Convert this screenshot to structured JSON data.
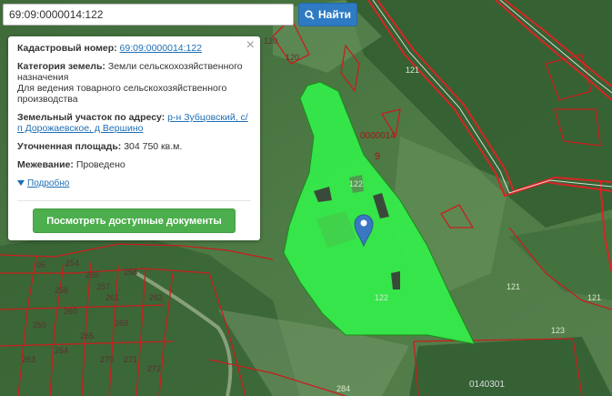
{
  "search": {
    "value": "69:09:0000014:122",
    "button_label": "Найти"
  },
  "popup": {
    "cadastral_label": "Кадастровый номер:",
    "cadastral_value": "69:09:0000014:122",
    "category_label": "Категория земель:",
    "category_value": "Земли сельскохозяйственного назначения",
    "purpose_value": "Для ведения товарного сельскохозяйственного производства",
    "address_label": "Земельный участок по адресу:",
    "address_value": "р-н Зубцовский, с/п Дорожаевское, д Вершино",
    "area_label": "Уточненная площадь:",
    "area_value": "304 750 кв.м.",
    "survey_label": "Межевание:",
    "survey_value": "Проведено",
    "more_label": "Подробно",
    "docs_button": "Посмотреть доступные документы",
    "close_glyph": "×"
  },
  "map": {
    "quarter_label": "0000014",
    "quarter_suffix": "9",
    "bottom_quarter_label": "0140301",
    "parcel_labels": [
      "121",
      "121",
      "121",
      "123",
      "122",
      "122",
      "120",
      "120",
      "254",
      "255",
      "256",
      "257",
      "258",
      "259",
      "260",
      "261",
      "262",
      "263",
      "264",
      "265",
      "269",
      "270",
      "271",
      "272",
      "284",
      "05"
    ]
  },
  "colors": {
    "selected_parcel": "#33ee4a",
    "boundary": "#c81e1e",
    "search_button": "#2e7bc4",
    "docs_button": "#4cae4c",
    "marker": "#3a78c2"
  },
  "icons": {
    "search": "search-icon",
    "marker": "map-marker-icon",
    "expand": "triangle-down-icon"
  }
}
